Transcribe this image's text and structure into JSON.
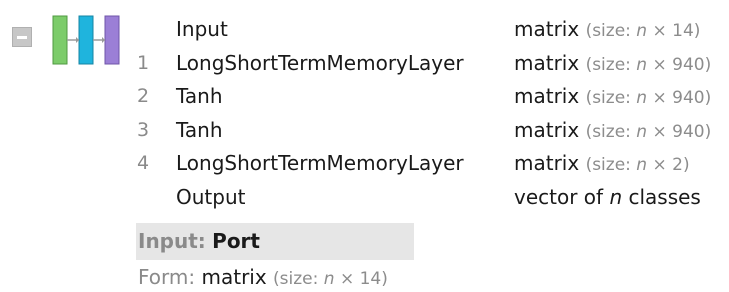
{
  "layers": [
    {
      "index": "",
      "name": "Input",
      "type": "matrix",
      "size_prefix": "(size: ",
      "n": "n",
      "size_suffix": " × 14)"
    },
    {
      "index": "1",
      "name": "LongShortTermMemoryLayer",
      "type": "matrix",
      "size_prefix": "(size: ",
      "n": "n",
      "size_suffix": " × 940)"
    },
    {
      "index": "2",
      "name": "Tanh",
      "type": "matrix",
      "size_prefix": "(size: ",
      "n": "n",
      "size_suffix": " × 940)"
    },
    {
      "index": "3",
      "name": "Tanh",
      "type": "matrix",
      "size_prefix": "(size: ",
      "n": "n",
      "size_suffix": " × 940)"
    },
    {
      "index": "4",
      "name": "LongShortTermMemoryLayer",
      "type": "matrix",
      "size_prefix": "(size: ",
      "n": "n",
      "size_suffix": " × 2)"
    }
  ],
  "output": {
    "name": "Output",
    "type_prefix": "vector of ",
    "n": "n",
    "type_suffix": " classes"
  },
  "port": {
    "label": "Input:",
    "value": "Port"
  },
  "form": {
    "label": "Form:",
    "value": "matrix",
    "size_prefix": "(size: ",
    "n": "n",
    "size_suffix": " × 14)"
  },
  "icons": {
    "toggle": "collapse-icon",
    "network": "network-chain-icon"
  },
  "colors": {
    "block_green": "#7ccc6a",
    "block_cyan": "#1fb4dd",
    "block_purple": "#9b7fd6"
  }
}
